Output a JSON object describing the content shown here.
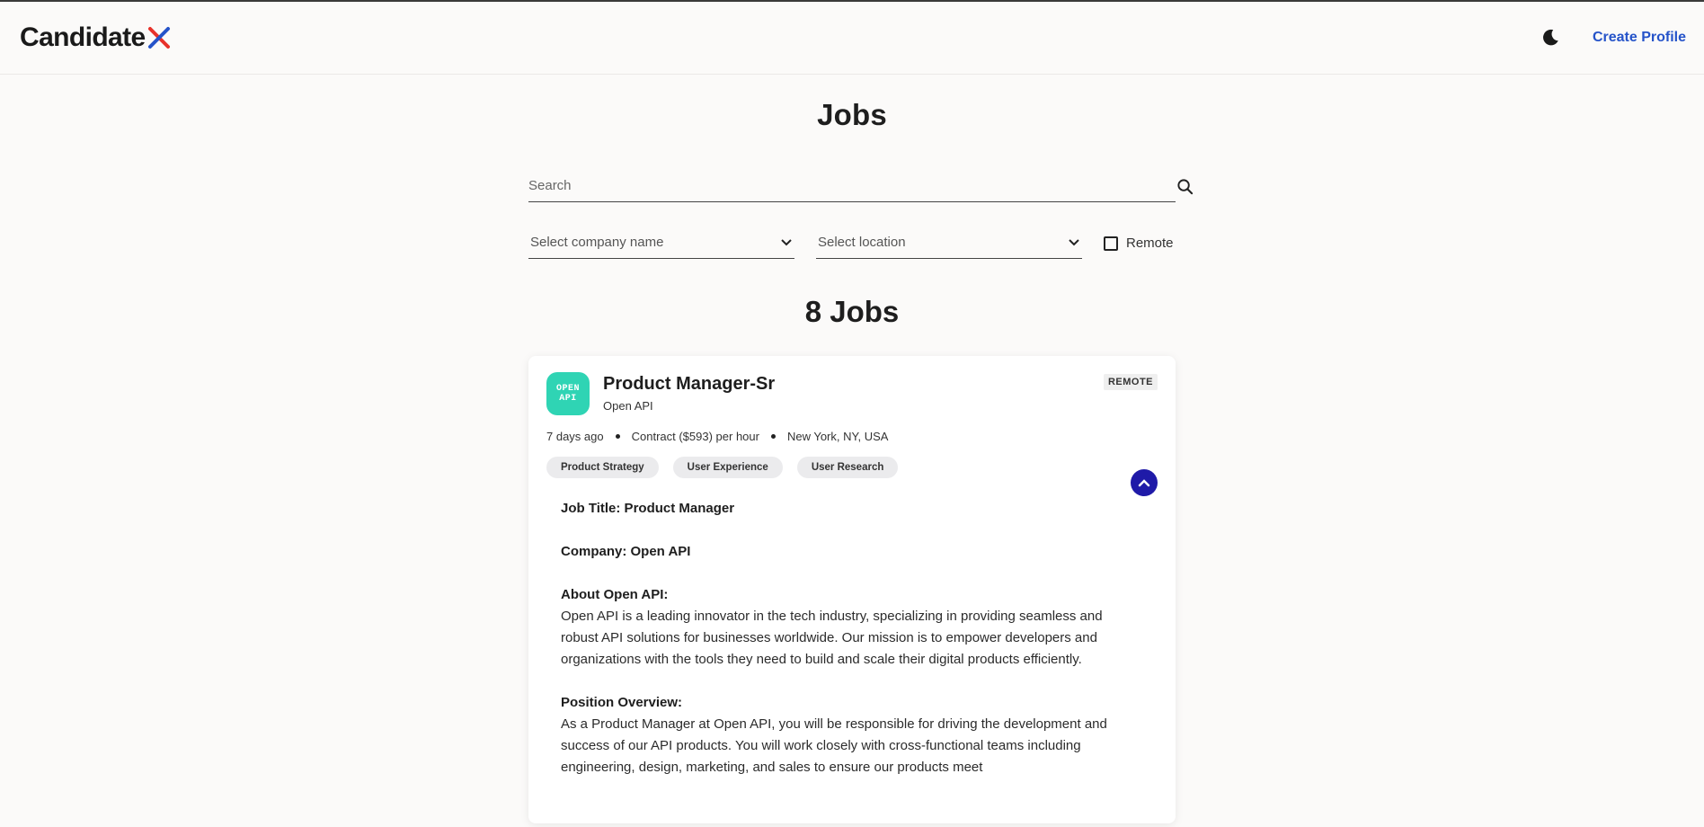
{
  "brand": {
    "logo_text": "Candidate",
    "logo_x_colors": [
      "#2553c9",
      "#e8322a"
    ]
  },
  "header": {
    "theme_icon": "moon-icon",
    "create_profile_label": "Create Profile"
  },
  "page": {
    "title": "Jobs",
    "search_placeholder": "Search",
    "company_select_placeholder": "Select company name",
    "location_select_placeholder": "Select location",
    "remote_label": "Remote",
    "remote_checked": false,
    "results_count": "8 Jobs"
  },
  "job": {
    "logo_line1": "OPEN",
    "logo_line2": "API",
    "logo_color": "#2fd4b4",
    "title": "Product Manager-Sr",
    "company": "Open API",
    "badge": "REMOTE",
    "posted": "7 days ago",
    "contract": "Contract ($593) per hour",
    "location": "New York, NY, USA",
    "tags": [
      "Product Strategy",
      "User Experience",
      "User Research"
    ],
    "collapse_button_color": "#1f1aa8",
    "description": {
      "job_title_line": "Job Title: Product Manager",
      "company_line": "Company: Open API",
      "about_heading": "About Open API:",
      "about_text": "Open API is a leading innovator in the tech industry, specializing in providing seamless and robust API solutions for businesses worldwide. Our mission is to empower developers and organizations with the tools they need to build and scale their digital products efficiently.",
      "overview_heading": "Position Overview:",
      "overview_text": "As a Product Manager at Open API, you will be responsible for driving the development and success of our API products. You will work closely with cross-functional teams including engineering, design, marketing, and sales to ensure our products meet"
    }
  }
}
